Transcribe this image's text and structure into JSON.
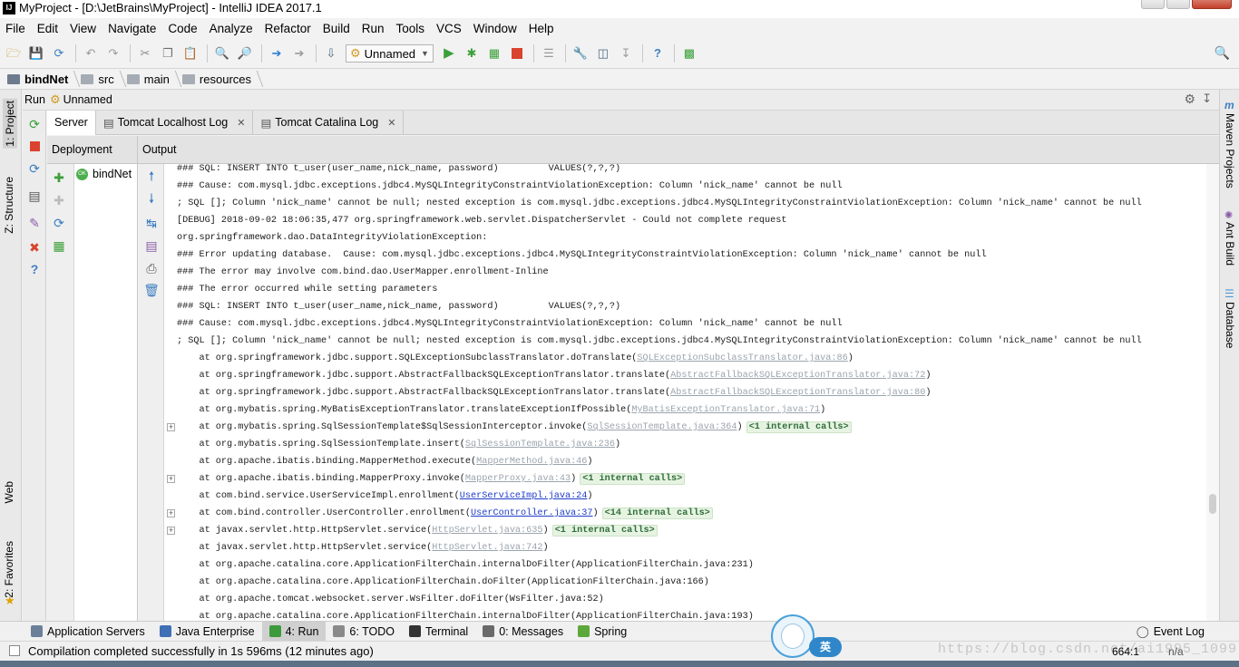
{
  "window": {
    "title": "MyProject - [D:\\JetBrains\\MyProject] - IntelliJ IDEA 2017.1",
    "app_icon": "IJ"
  },
  "menu": [
    "File",
    "Edit",
    "View",
    "Navigate",
    "Code",
    "Analyze",
    "Refactor",
    "Build",
    "Run",
    "Tools",
    "VCS",
    "Window",
    "Help"
  ],
  "toolbar": {
    "run_config": "Unnamed"
  },
  "breadcrumb": [
    "bindNet",
    "src",
    "main",
    "resources"
  ],
  "left_stripe": {
    "project": "1: Project",
    "structure": "Z: Structure",
    "web": "Web",
    "favorites": "2: Favorites"
  },
  "right_stripe": {
    "maven": "Maven Projects",
    "ant": "Ant Build",
    "database": "Database"
  },
  "run_panel": {
    "label": "Run",
    "config": "Unnamed"
  },
  "tabs": [
    "Server",
    "Tomcat Localhost Log",
    "Tomcat Catalina Log"
  ],
  "deployment": {
    "header": "Deployment",
    "item": "bindNet"
  },
  "output": {
    "header": "Output",
    "lines": [
      {
        "t": "### SQL: INSERT INTO t_user(user_name,nick_name, password)         VALUES(?,?,?)"
      },
      {
        "t": "### Cause: com.mysql.jdbc.exceptions.jdbc4.MySQLIntegrityConstraintViolationException: Column 'nick_name' cannot be null"
      },
      {
        "t": "; SQL []; Column 'nick_name' cannot be null; nested exception is com.mysql.jdbc.exceptions.jdbc4.MySQLIntegrityConstraintViolationException: Column 'nick_name' cannot be null"
      },
      {
        "t": "[DEBUG] 2018-09-02 18:06:35,477 org.springframework.web.servlet.DispatcherServlet - Could not complete request"
      },
      {
        "t": "org.springframework.dao.DataIntegrityViolationException:"
      },
      {
        "t": "### Error updating database.  Cause: com.mysql.jdbc.exceptions.jdbc4.MySQLIntegrityConstraintViolationException: Column 'nick_name' cannot be null"
      },
      {
        "t": "### The error may involve com.bind.dao.UserMapper.enrollment-Inline"
      },
      {
        "t": "### The error occurred while setting parameters"
      },
      {
        "t": "### SQL: INSERT INTO t_user(user_name,nick_name, password)         VALUES(?,?,?)"
      },
      {
        "t": "### Cause: com.mysql.jdbc.exceptions.jdbc4.MySQLIntegrityConstraintViolationException: Column 'nick_name' cannot be null"
      },
      {
        "t": "; SQL []; Column 'nick_name' cannot be null; nested exception is com.mysql.jdbc.exceptions.jdbc4.MySQLIntegrityConstraintViolationException: Column 'nick_name' cannot be null"
      },
      {
        "t": "    at org.springframework.jdbc.support.SQLExceptionSubclassTranslator.doTranslate(",
        "link": "SQLExceptionSubclassTranslator.java:86",
        "post": ")"
      },
      {
        "t": "    at org.springframework.jdbc.support.AbstractFallbackSQLExceptionTranslator.translate(",
        "link": "AbstractFallbackSQLExceptionTranslator.java:72",
        "post": ")"
      },
      {
        "t": "    at org.springframework.jdbc.support.AbstractFallbackSQLExceptionTranslator.translate(",
        "link": "AbstractFallbackSQLExceptionTranslator.java:80",
        "post": ")"
      },
      {
        "t": "    at org.mybatis.spring.MyBatisExceptionTranslator.translateExceptionIfPossible(",
        "link": "MyBatisExceptionTranslator.java:71",
        "post": ")"
      },
      {
        "t": "    at org.mybatis.spring.SqlSessionTemplate$SqlSessionInterceptor.invoke(",
        "link": "SqlSessionTemplate.java:364",
        "post": ")",
        "fold": "<1 internal calls>",
        "plus": true
      },
      {
        "t": "    at org.mybatis.spring.SqlSessionTemplate.insert(",
        "link": "SqlSessionTemplate.java:236",
        "post": ")"
      },
      {
        "t": "    at org.apache.ibatis.binding.MapperMethod.execute(",
        "link": "MapperMethod.java:46",
        "post": ")"
      },
      {
        "t": "    at org.apache.ibatis.binding.MapperProxy.invoke(",
        "link": "MapperProxy.java:43",
        "post": ")",
        "fold": "<1 internal calls>",
        "plus": true
      },
      {
        "t": "    at com.bind.service.UserServiceImpl.enrollment(",
        "link": "UserServiceImpl.java:24",
        "post": ")",
        "active": true
      },
      {
        "t": "    at com.bind.controller.UserController.enrollment(",
        "link": "UserController.java:37",
        "post": ")",
        "fold": "<14 internal calls>",
        "plus": true,
        "active": true
      },
      {
        "t": "    at javax.servlet.http.HttpServlet.service(",
        "link": "HttpServlet.java:635",
        "post": ")",
        "fold": "<1 internal calls>",
        "plus": true
      },
      {
        "t": "    at javax.servlet.http.HttpServlet.service(",
        "link": "HttpServlet.java:742",
        "post": ")"
      },
      {
        "t": "    at org.apache.catalina.core.ApplicationFilterChain.internalDoFilter(ApplicationFilterChain.java:231)"
      },
      {
        "t": "    at org.apache.catalina.core.ApplicationFilterChain.doFilter(ApplicationFilterChain.java:166)"
      },
      {
        "t": "    at org.apache.tomcat.websocket.server.WsFilter.doFilter(WsFilter.java:52)"
      },
      {
        "t": "    at org.apache.catalina.core.ApplicationFilterChain.internalDoFilter(ApplicationFilterChain.java:193)"
      }
    ]
  },
  "bottom_tabs": [
    {
      "label": "Application Servers",
      "icon": "app-servers-icon",
      "color": "#6b7f99"
    },
    {
      "label": "Java Enterprise",
      "icon": "java-enterprise-icon",
      "color": "#3f6fb5"
    },
    {
      "label": "4: Run",
      "icon": "run-icon",
      "color": "#3c9a3c",
      "active": true
    },
    {
      "label": "6: TODO",
      "icon": "todo-icon",
      "color": "#8a8a8a"
    },
    {
      "label": "Terminal",
      "icon": "terminal-icon",
      "color": "#333333"
    },
    {
      "label": "0: Messages",
      "icon": "messages-icon",
      "color": "#6a6a6a"
    },
    {
      "label": "Spring",
      "icon": "spring-icon",
      "color": "#5da83a"
    }
  ],
  "event_log": "Event Log",
  "status": {
    "message": "Compilation completed successfully in 1s 596ms (12 minutes ago)",
    "caret": "664:1",
    "line_ending": "n/a"
  },
  "watermark": "https://blog.csdn.net/ai1995_1099",
  "ime": {
    "label": "英"
  }
}
